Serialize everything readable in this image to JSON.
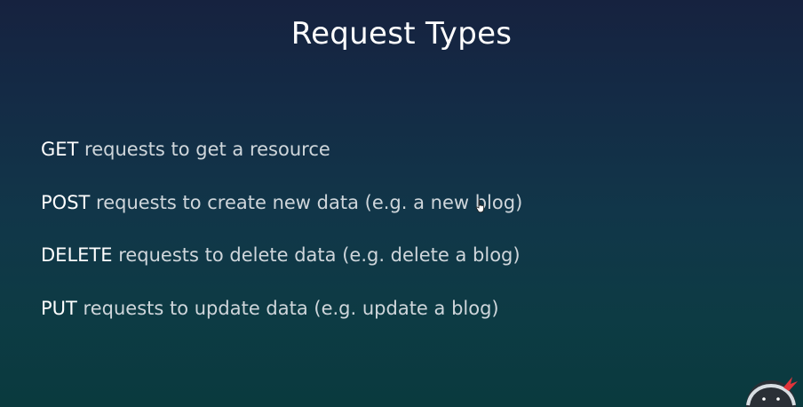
{
  "slide": {
    "title": "Request Types",
    "items": [
      {
        "method": "GET",
        "text": " requests to get a resource"
      },
      {
        "method": "POST",
        "text": " requests to create new data (e.g. a new blog)"
      },
      {
        "method": "DELETE",
        "text": " requests to delete data (e.g. delete a blog)"
      },
      {
        "method": "PUT",
        "text": " requests to update data (e.g. update a blog)"
      }
    ]
  },
  "icons": {
    "cursor": "hand-pointer-icon",
    "logo": "ninja-logo-icon"
  },
  "colors": {
    "background_top": "#16223f",
    "background_bottom": "#0a3a3e",
    "text": "#ffffff",
    "logo_accent": "#e0343a"
  }
}
